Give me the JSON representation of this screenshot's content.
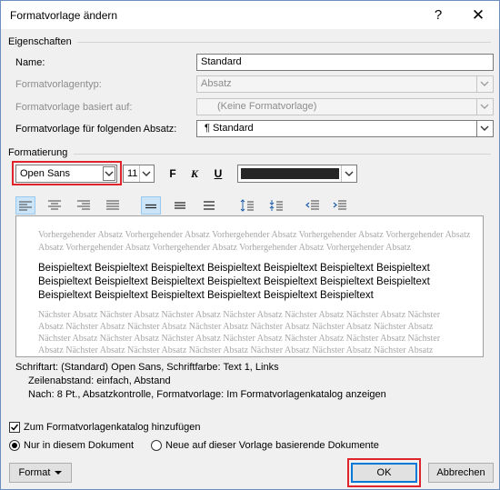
{
  "window": {
    "title": "Formatvorlage ändern",
    "help_label": "?",
    "close_label": "✕"
  },
  "eigenschaften": {
    "header": "Eigenschaften",
    "name_label": "Name:",
    "name_value": "Standard",
    "typ_label": "Formatvorlagentyp:",
    "typ_value": "Absatz",
    "basiert_label": "Formatvorlage basiert auf:",
    "basiert_value": "(Keine Formatvorlage)",
    "folgend_label": "Formatvorlage für folgenden Absatz:",
    "folgend_value": "¶  Standard"
  },
  "formatierung": {
    "header": "Formatierung",
    "font_value": "Open Sans",
    "size_value": "11",
    "bold_label": "F",
    "italic_label": "K",
    "underline_label": "U",
    "color_value": "#262626"
  },
  "preview": {
    "prev_lines": [
      "Vorhergehender Absatz Vorhergehender Absatz Vorhergehender Absatz Vorhergehender Absatz Vorhergehender Absatz",
      "Absatz Vorhergehender Absatz Vorhergehender Absatz Vorhergehender Absatz Vorhergehender Absatz"
    ],
    "main_lines": [
      "Beispieltext Beispieltext Beispieltext Beispieltext Beispieltext Beispieltext Beispieltext",
      "Beispieltext Beispieltext Beispieltext Beispieltext Beispieltext Beispieltext Beispieltext",
      "Beispieltext Beispieltext Beispieltext Beispieltext Beispieltext Beispieltext"
    ],
    "next_lines": [
      "Nächster Absatz Nächster Absatz Nächster Absatz Nächster Absatz Nächster Absatz Nächster Absatz Nächster",
      "Absatz Nächster Absatz Nächster Absatz Nächster Absatz Nächster Absatz Nächster Absatz Nächster Absatz",
      "Nächster Absatz Nächster Absatz Nächster Absatz Nächster Absatz Nächster Absatz Nächster Absatz Nächster",
      "Absatz Nächster Absatz Nächster Absatz Nächster Absatz Nächster Absatz Nächster Absatz Nächster Absatz"
    ]
  },
  "description": {
    "line1": "Schriftart: (Standard) Open Sans, Schriftfarbe: Text 1, Links",
    "line2": "Zeilenabstand:  einfach, Abstand",
    "line3": "Nach:  8 Pt., Absatzkontrolle, Formatvorlage: Im Formatvorlagenkatalog anzeigen"
  },
  "options": {
    "katalog_label": "Zum Formatvorlagenkatalog hinzufügen",
    "katalog_checked": true,
    "nur_label": "Nur in diesem Dokument",
    "neue_label": "Neue auf dieser Vorlage basierende Dokumente"
  },
  "buttons": {
    "format_label": "Format",
    "ok_label": "OK",
    "abbrechen_label": "Abbrechen"
  }
}
